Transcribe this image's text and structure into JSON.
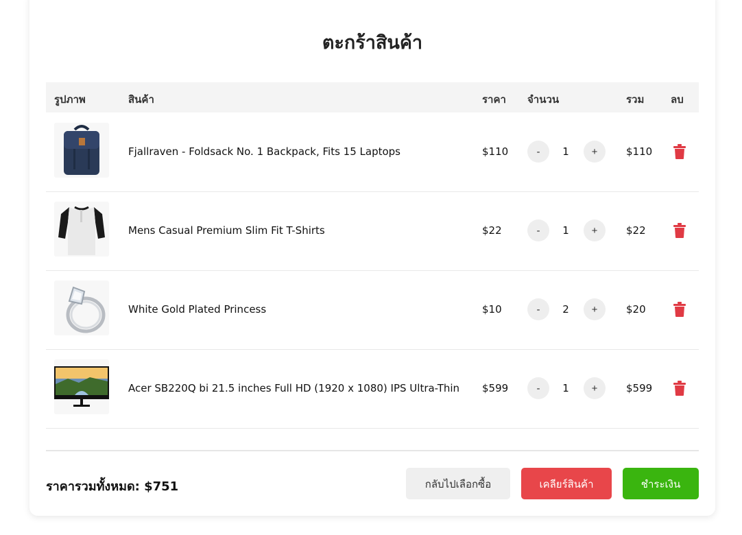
{
  "cart": {
    "title": "ตะกร้าสินค้า",
    "headers": {
      "image": "รูปภาพ",
      "product": "สินค้า",
      "price": "ราคา",
      "quantity": "จำนวน",
      "total": "รวม",
      "delete": "ลบ"
    },
    "items": [
      {
        "name": "Fjallraven - Foldsack No. 1 Backpack, Fits 15 Laptops",
        "price": "$110",
        "minus_label": "-",
        "qty": "1",
        "plus_label": "+",
        "total": "$110",
        "icon": "backpack-image"
      },
      {
        "name": "Mens Casual Premium Slim Fit T-Shirts",
        "price": "$22",
        "minus_label": "-",
        "qty": "1",
        "plus_label": "+",
        "total": "$22",
        "icon": "tshirt-image"
      },
      {
        "name": "White Gold Plated Princess",
        "price": "$10",
        "minus_label": "-",
        "qty": "2",
        "plus_label": "+",
        "total": "$20",
        "icon": "ring-image"
      },
      {
        "name": "Acer SB220Q bi 21.5 inches Full HD (1920 x 1080) IPS Ultra-Thin",
        "price": "$599",
        "minus_label": "-",
        "qty": "1",
        "plus_label": "+",
        "total": "$599",
        "icon": "monitor-image"
      }
    ],
    "grand_total": "ราคารวมทั้งหมด: $751",
    "buttons": {
      "back": "กลับไปเลือกซื้อ",
      "clear": "เคลียร์สินค้า",
      "checkout": "ชำระเงิน"
    },
    "colors": {
      "delete_icon": "#e03a44",
      "clear_button": "#e8464a",
      "checkout_button": "#3ab50f",
      "back_button": "#efefef"
    }
  }
}
